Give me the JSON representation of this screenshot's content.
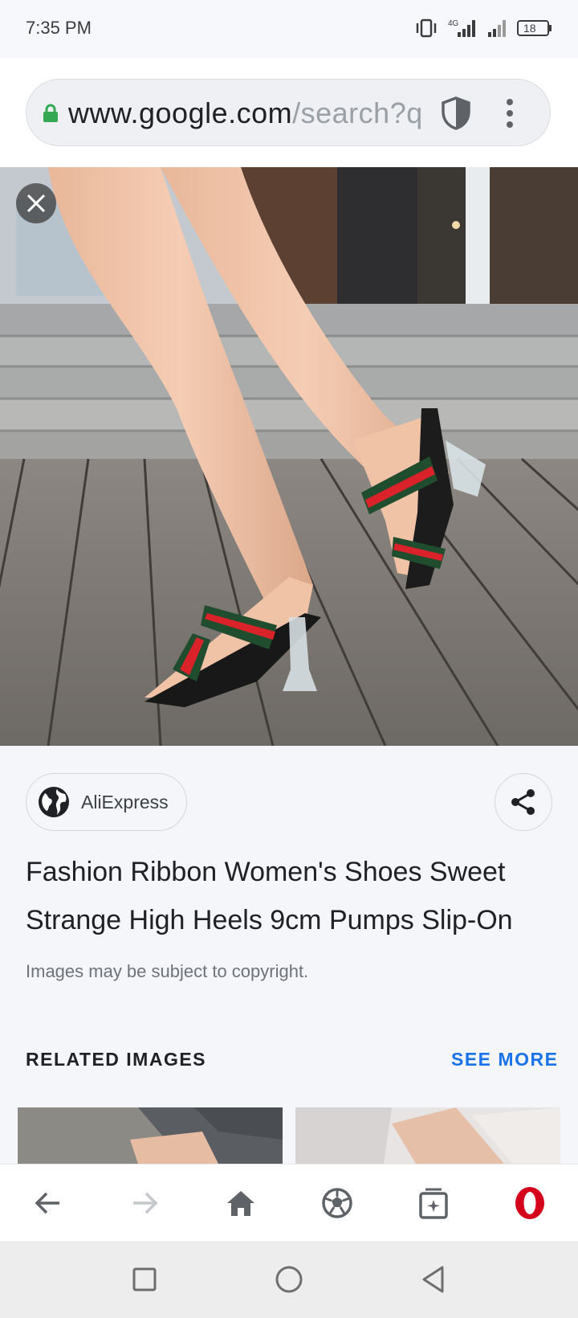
{
  "status_bar": {
    "time": "7:35 PM",
    "network": "4G",
    "battery": "18",
    "icons": [
      "vibrate-icon",
      "signal-4g-icon",
      "signal-icon",
      "battery-icon"
    ]
  },
  "browser": {
    "url_host": "www.google.com",
    "url_path": "/search?q",
    "icons": [
      "lock-icon",
      "shield-icon",
      "more-vert-icon"
    ]
  },
  "image_viewer": {
    "close_icon": "close-icon",
    "source": {
      "name": "AliExpress",
      "icon": "globe-icon"
    },
    "share_icon": "share-icon",
    "title": "Fashion Ribbon Women's Shoes Sweet Strange High Heels 9cm Pumps Slip-On",
    "copyright": "Images may be subject to copyright."
  },
  "related": {
    "label": "RELATED IMAGES",
    "see_more": "SEE MORE"
  },
  "toolbar": {
    "items": [
      "back-icon",
      "forward-icon",
      "home-icon",
      "vpn-ball-icon",
      "tabs-icon",
      "opera-icon"
    ]
  },
  "nav": {
    "items": [
      "recents-icon",
      "home-circle-icon",
      "back-triangle-icon"
    ]
  },
  "colors": {
    "accent": "#1a73e8",
    "lock": "#34a853",
    "opera": "#d5001c"
  }
}
